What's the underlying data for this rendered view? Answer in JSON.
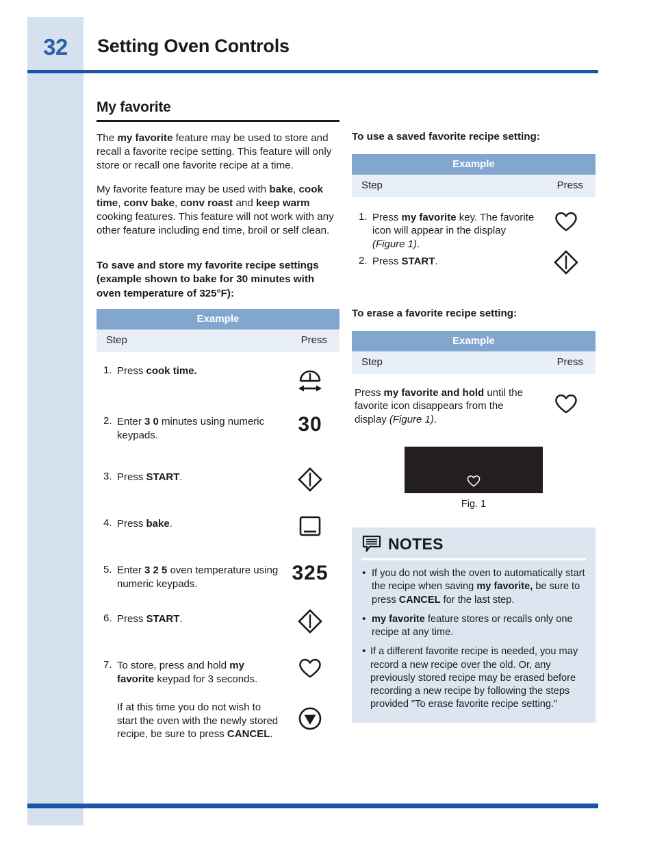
{
  "page": {
    "number": "32",
    "title": "Setting Oven Controls"
  },
  "left_column": {
    "section_title": "My favorite",
    "intro_paragraph_1": {
      "a": "The ",
      "b": "my favorite",
      "c": " feature may be used to store and recall a favorite recipe setting. This feature will only store or recall one favorite recipe at a time."
    },
    "intro_paragraph_2": {
      "a": "My favorite feature may be used with ",
      "b1": "bake",
      "c1": ", ",
      "b2": "cook time",
      "c2": ", ",
      "b3": "conv bake",
      "c3": ", ",
      "b4": "conv roast",
      "c4": " and ",
      "b5": "keep warm",
      "c5": " cooking features. This feature will not work with any other feature including end time, broil or self clean."
    },
    "save_heading": "To save and store my favorite recipe settings (example shown to bake for 30 minutes with oven temperature of 325°F):",
    "table": {
      "header": "Example",
      "col_step": "Step",
      "col_press": "Press",
      "rows": [
        {
          "num": "1.",
          "text_a": "Press ",
          "text_b": "cook time.",
          "text_c": "",
          "press_kind": "icon",
          "press_icon": "cook-time-icon",
          "press_value": ""
        },
        {
          "num": "2.",
          "text_a": "Enter ",
          "text_b": "3 0",
          "text_c": " minutes using numeric keypads.",
          "press_kind": "number",
          "press_icon": "",
          "press_value": "30"
        },
        {
          "num": "3.",
          "text_a": "Press ",
          "text_b": "START",
          "text_c": ".",
          "press_kind": "icon",
          "press_icon": "start-icon",
          "press_value": ""
        },
        {
          "num": "4.",
          "text_a": "Press ",
          "text_b": "bake",
          "text_c": ".",
          "press_kind": "icon",
          "press_icon": "bake-icon",
          "press_value": ""
        },
        {
          "num": "5.",
          "text_a": "Enter ",
          "text_b": "3 2 5",
          "text_c": " oven temperature using numeric keypads.",
          "press_kind": "number",
          "press_icon": "",
          "press_value": "325"
        },
        {
          "num": "6.",
          "text_a": "Press ",
          "text_b": "START",
          "text_c": ".",
          "press_kind": "icon",
          "press_icon": "start-icon",
          "press_value": ""
        },
        {
          "num": "7.",
          "text_a": "To store, press and hold ",
          "text_b": "my favorite",
          "text_c": " keypad for 3 seconds.",
          "press_kind": "icon",
          "press_icon": "favorite-heart-icon",
          "press_value": ""
        }
      ],
      "closing_note": {
        "a": "If at this time you do not wish to start the oven with the newly stored recipe, be sure to press ",
        "b": "CANCEL",
        "c": ".",
        "press_icon": "cancel-icon"
      }
    }
  },
  "right_column": {
    "use_heading": "To use a saved favorite recipe setting:",
    "use_table": {
      "header": "Example",
      "col_step": "Step",
      "col_press": "Press",
      "rows": [
        {
          "num": "1.",
          "text_a": "Press ",
          "text_b": "my favorite",
          "text_c": " key. The favorite icon will appear in the display ",
          "text_i": "(Figure 1)",
          "text_d": ".",
          "press_icon": "favorite-heart-icon"
        },
        {
          "num": "2.",
          "text_a": "Press ",
          "text_b": "START",
          "text_c": ".",
          "text_i": "",
          "text_d": "",
          "press_icon": "start-icon"
        }
      ]
    },
    "erase_heading": "To erase a favorite recipe setting:",
    "erase_table": {
      "header": "Example",
      "col_step": "Step",
      "col_press": "Press",
      "row": {
        "text_a": "Press ",
        "text_b": "my favorite and hold",
        "text_c": " until the favorite icon disappears from the display ",
        "text_i": "(Figure 1)",
        "text_d": ".",
        "press_icon": "favorite-heart-icon"
      }
    },
    "figure": {
      "caption": "Fig. 1",
      "display_icon": "favorite-heart-icon",
      "display_background": "#231f20"
    },
    "notes": {
      "icon": "notes-speech-bubble-icon",
      "title": "NOTES",
      "items": [
        {
          "a": "If you do not wish the oven to automatically start the recipe when saving ",
          "b": "my favorite,",
          "c": " be sure to press ",
          "b2": "CANCEL",
          "d": " for the last step."
        },
        {
          "a": "",
          "b": "my favorite",
          "c": " feature stores or recalls only one recipe at any time.",
          "b2": "",
          "d": ""
        },
        {
          "a": "If a different favorite recipe is needed, you may record a new recipe over the old. Or, any previously stored recipe may be erased before recording a new recipe by following the steps provided \"To erase favorite recipe setting.\"",
          "b": "",
          "c": "",
          "b2": "",
          "d": ""
        }
      ]
    }
  },
  "colors": {
    "accent_blue": "#1b55a8",
    "page_number_blue": "#2b60ad",
    "side_band": "#d6e1ef",
    "table_header": "#83a6ce",
    "table_subhead": "#e8eff7",
    "notes_background": "#dce6f1",
    "display_black": "#231f20"
  }
}
